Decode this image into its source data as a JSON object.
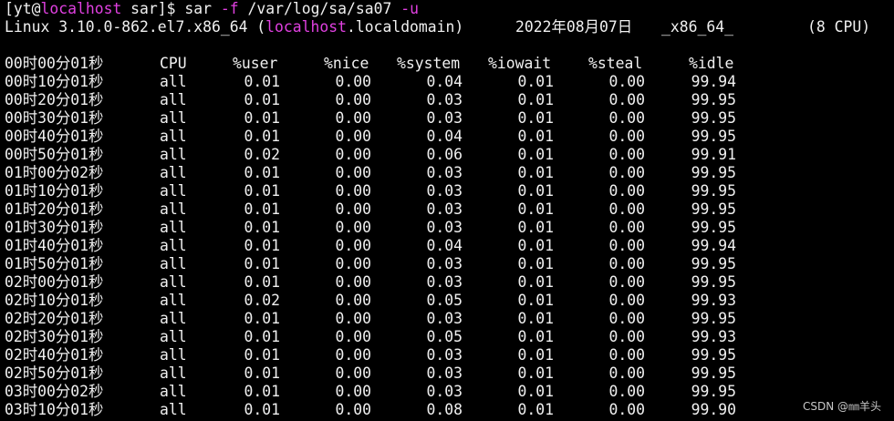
{
  "prompt": {
    "open_bracket": "[",
    "user": "yt",
    "at": "@",
    "host": "localhost",
    "cwd_part": " sar]$ ",
    "command": "sar",
    "flag_f": "-f",
    "file": "/var/log/sa/sa07",
    "flag_u": "-u"
  },
  "sysinfo": {
    "kernel": "Linux 3.10.0-862.el7.x86_64 (",
    "host_highlight": "localhost",
    "domain_rest": ".localdomain)",
    "date": "2022年08月07日",
    "arch": "_x86_64_",
    "cpus": "(8 CPU)"
  },
  "table": {
    "header": {
      "time": "00时00分01秒",
      "cpu": "CPU",
      "user": "%user",
      "nice": "%nice",
      "system": "%system",
      "iowait": "%iowait",
      "steal": "%steal",
      "idle": "%idle"
    },
    "rows": [
      {
        "time": "00时10分01秒",
        "cpu": "all",
        "user": "0.01",
        "nice": "0.00",
        "system": "0.04",
        "iowait": "0.01",
        "steal": "0.00",
        "idle": "99.94"
      },
      {
        "time": "00时20分01秒",
        "cpu": "all",
        "user": "0.01",
        "nice": "0.00",
        "system": "0.03",
        "iowait": "0.01",
        "steal": "0.00",
        "idle": "99.95"
      },
      {
        "time": "00时30分01秒",
        "cpu": "all",
        "user": "0.01",
        "nice": "0.00",
        "system": "0.03",
        "iowait": "0.01",
        "steal": "0.00",
        "idle": "99.95"
      },
      {
        "time": "00时40分01秒",
        "cpu": "all",
        "user": "0.01",
        "nice": "0.00",
        "system": "0.04",
        "iowait": "0.01",
        "steal": "0.00",
        "idle": "99.95"
      },
      {
        "time": "00时50分01秒",
        "cpu": "all",
        "user": "0.02",
        "nice": "0.00",
        "system": "0.06",
        "iowait": "0.01",
        "steal": "0.00",
        "idle": "99.91"
      },
      {
        "time": "01时00分02秒",
        "cpu": "all",
        "user": "0.01",
        "nice": "0.00",
        "system": "0.03",
        "iowait": "0.01",
        "steal": "0.00",
        "idle": "99.95"
      },
      {
        "time": "01时10分01秒",
        "cpu": "all",
        "user": "0.01",
        "nice": "0.00",
        "system": "0.03",
        "iowait": "0.01",
        "steal": "0.00",
        "idle": "99.95"
      },
      {
        "time": "01时20分01秒",
        "cpu": "all",
        "user": "0.01",
        "nice": "0.00",
        "system": "0.03",
        "iowait": "0.01",
        "steal": "0.00",
        "idle": "99.95"
      },
      {
        "time": "01时30分01秒",
        "cpu": "all",
        "user": "0.01",
        "nice": "0.00",
        "system": "0.03",
        "iowait": "0.01",
        "steal": "0.00",
        "idle": "99.95"
      },
      {
        "time": "01时40分01秒",
        "cpu": "all",
        "user": "0.01",
        "nice": "0.00",
        "system": "0.04",
        "iowait": "0.01",
        "steal": "0.00",
        "idle": "99.94"
      },
      {
        "time": "01时50分01秒",
        "cpu": "all",
        "user": "0.01",
        "nice": "0.00",
        "system": "0.03",
        "iowait": "0.01",
        "steal": "0.00",
        "idle": "99.95"
      },
      {
        "time": "02时00分01秒",
        "cpu": "all",
        "user": "0.01",
        "nice": "0.00",
        "system": "0.03",
        "iowait": "0.01",
        "steal": "0.00",
        "idle": "99.95"
      },
      {
        "time": "02时10分01秒",
        "cpu": "all",
        "user": "0.02",
        "nice": "0.00",
        "system": "0.05",
        "iowait": "0.01",
        "steal": "0.00",
        "idle": "99.93"
      },
      {
        "time": "02时20分01秒",
        "cpu": "all",
        "user": "0.01",
        "nice": "0.00",
        "system": "0.03",
        "iowait": "0.01",
        "steal": "0.00",
        "idle": "99.95"
      },
      {
        "time": "02时30分01秒",
        "cpu": "all",
        "user": "0.01",
        "nice": "0.00",
        "system": "0.05",
        "iowait": "0.01",
        "steal": "0.00",
        "idle": "99.93"
      },
      {
        "time": "02时40分01秒",
        "cpu": "all",
        "user": "0.01",
        "nice": "0.00",
        "system": "0.03",
        "iowait": "0.01",
        "steal": "0.00",
        "idle": "99.95"
      },
      {
        "time": "02时50分01秒",
        "cpu": "all",
        "user": "0.01",
        "nice": "0.00",
        "system": "0.03",
        "iowait": "0.01",
        "steal": "0.00",
        "idle": "99.95"
      },
      {
        "time": "03时00分02秒",
        "cpu": "all",
        "user": "0.01",
        "nice": "0.00",
        "system": "0.03",
        "iowait": "0.01",
        "steal": "0.00",
        "idle": "99.95"
      },
      {
        "time": "03时10分01秒",
        "cpu": "all",
        "user": "0.01",
        "nice": "0.00",
        "system": "0.08",
        "iowait": "0.01",
        "steal": "0.00",
        "idle": "99.90"
      }
    ]
  },
  "watermark": "CSDN @㎜羊头",
  "colors": {
    "background": "#000000",
    "text": "#f0f0f0",
    "highlight": "#e040e0"
  }
}
